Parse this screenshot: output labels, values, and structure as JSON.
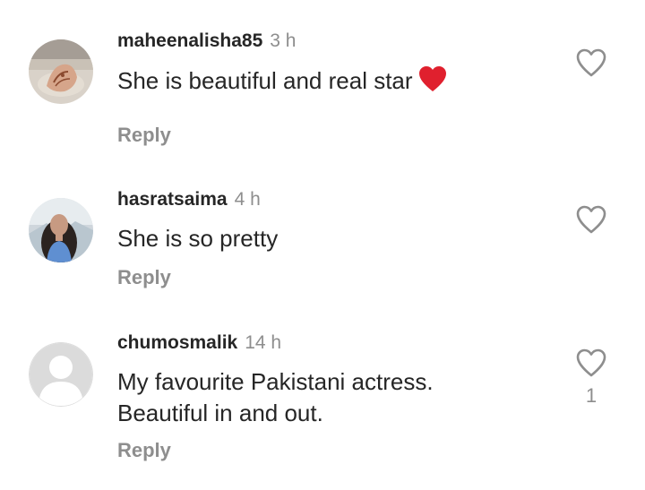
{
  "comments": [
    {
      "username": "maheenalisha85",
      "time": "3 h",
      "text": "She is beautiful and real star",
      "emoji": "red-heart-emoji",
      "reply_label": "Reply",
      "avatar": "hands-with-henna-photo"
    },
    {
      "username": "hasratsaima",
      "time": "4 h",
      "text": "She is so pretty",
      "reply_label": "Reply",
      "avatar": "woman-portrait-photo"
    },
    {
      "username": "chumosmalik",
      "time": "14 h",
      "text_line1": "My favourite Pakistani actress.",
      "text_line2": "Beautiful in and out.",
      "reply_label": "Reply",
      "avatar": "default-avatar",
      "like_count": "1"
    }
  ],
  "colors": {
    "primary_text": "#262626",
    "secondary_text": "#8e8e8e",
    "heart_emoji": "#e0202e",
    "default_avatar_bg": "#dbdbdb"
  }
}
